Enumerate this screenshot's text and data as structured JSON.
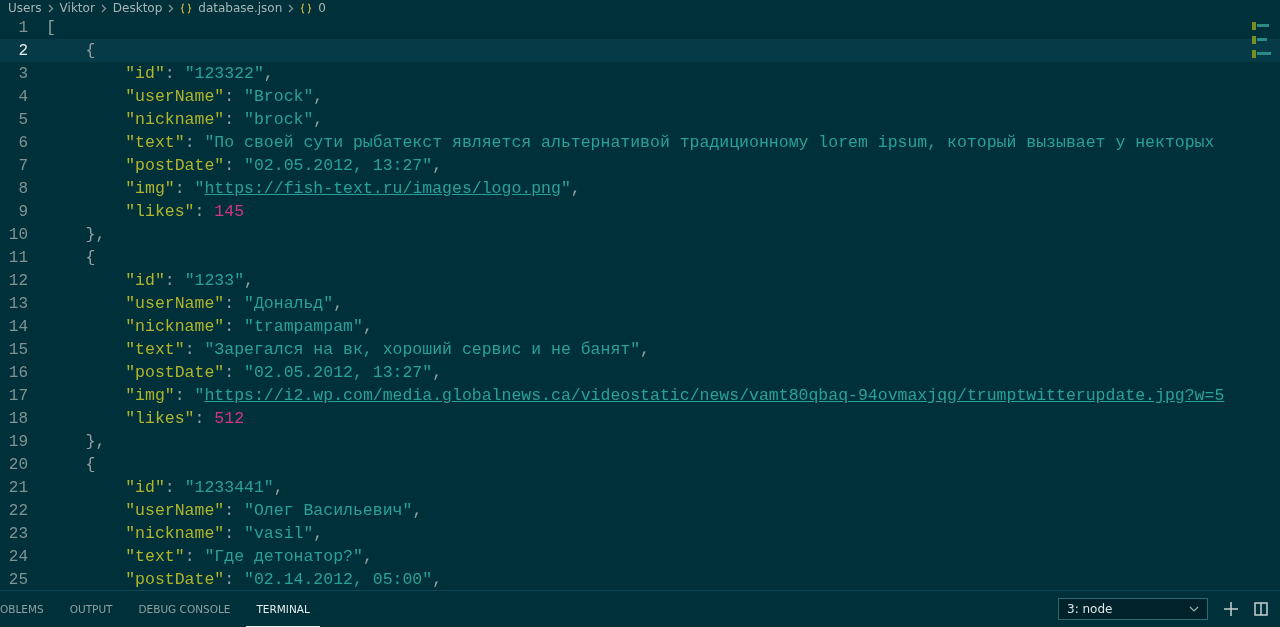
{
  "breadcrumb": [
    {
      "label": "Users",
      "kind": "folder"
    },
    {
      "label": "Viktor",
      "kind": "folder"
    },
    {
      "label": "Desktop",
      "kind": "folder"
    },
    {
      "label": "database.json",
      "kind": "json"
    },
    {
      "label": "0",
      "kind": "json"
    }
  ],
  "editor": {
    "lines": [
      {
        "number": "1",
        "current": false,
        "tokens": [
          {
            "kind": "punct",
            "text": "["
          }
        ]
      },
      {
        "number": "2",
        "current": true,
        "tokens": [
          {
            "kind": "punct",
            "text": "    {"
          }
        ]
      },
      {
        "number": "3",
        "current": false,
        "tokens": [
          {
            "kind": "key",
            "text": "        \"id\""
          },
          {
            "kind": "punct",
            "text": ": "
          },
          {
            "kind": "string",
            "text": "\"123322\""
          },
          {
            "kind": "punct",
            "text": ","
          }
        ]
      },
      {
        "number": "4",
        "current": false,
        "tokens": [
          {
            "kind": "key",
            "text": "        \"userName\""
          },
          {
            "kind": "punct",
            "text": ": "
          },
          {
            "kind": "string",
            "text": "\"Brock\""
          },
          {
            "kind": "punct",
            "text": ","
          }
        ]
      },
      {
        "number": "5",
        "current": false,
        "tokens": [
          {
            "kind": "key",
            "text": "        \"nickname\""
          },
          {
            "kind": "punct",
            "text": ": "
          },
          {
            "kind": "string",
            "text": "\"brock\""
          },
          {
            "kind": "punct",
            "text": ","
          }
        ]
      },
      {
        "number": "6",
        "current": false,
        "tokens": [
          {
            "kind": "key",
            "text": "        \"text\""
          },
          {
            "kind": "punct",
            "text": ": "
          },
          {
            "kind": "string",
            "text": "\"По своей сути рыбатекст является альтернативой традиционному lorem ipsum, который вызывает у некторых"
          }
        ]
      },
      {
        "number": "7",
        "current": false,
        "tokens": [
          {
            "kind": "key",
            "text": "        \"postDate\""
          },
          {
            "kind": "punct",
            "text": ": "
          },
          {
            "kind": "string",
            "text": "\"02.05.2012, 13:27\""
          },
          {
            "kind": "punct",
            "text": ","
          }
        ]
      },
      {
        "number": "8",
        "current": false,
        "tokens": [
          {
            "kind": "key",
            "text": "        \"img\""
          },
          {
            "kind": "punct",
            "text": ": "
          },
          {
            "kind": "string",
            "text": "\""
          },
          {
            "kind": "link",
            "text": "https://fish-text.ru/images/logo.png"
          },
          {
            "kind": "string",
            "text": "\""
          },
          {
            "kind": "punct",
            "text": ","
          }
        ]
      },
      {
        "number": "9",
        "current": false,
        "tokens": [
          {
            "kind": "key",
            "text": "        \"likes\""
          },
          {
            "kind": "punct",
            "text": ": "
          },
          {
            "kind": "number",
            "text": "145"
          }
        ]
      },
      {
        "number": "10",
        "current": false,
        "tokens": [
          {
            "kind": "punct",
            "text": "    },"
          }
        ]
      },
      {
        "number": "11",
        "current": false,
        "tokens": [
          {
            "kind": "punct",
            "text": "    {"
          }
        ]
      },
      {
        "number": "12",
        "current": false,
        "tokens": [
          {
            "kind": "key",
            "text": "        \"id\""
          },
          {
            "kind": "punct",
            "text": ": "
          },
          {
            "kind": "string",
            "text": "\"1233\""
          },
          {
            "kind": "punct",
            "text": ","
          }
        ]
      },
      {
        "number": "13",
        "current": false,
        "tokens": [
          {
            "kind": "key",
            "text": "        \"userName\""
          },
          {
            "kind": "punct",
            "text": ": "
          },
          {
            "kind": "string",
            "text": "\"Дональд\""
          },
          {
            "kind": "punct",
            "text": ","
          }
        ]
      },
      {
        "number": "14",
        "current": false,
        "tokens": [
          {
            "kind": "key",
            "text": "        \"nickname\""
          },
          {
            "kind": "punct",
            "text": ": "
          },
          {
            "kind": "string",
            "text": "\"trampampam\""
          },
          {
            "kind": "punct",
            "text": ","
          }
        ]
      },
      {
        "number": "15",
        "current": false,
        "tokens": [
          {
            "kind": "key",
            "text": "        \"text\""
          },
          {
            "kind": "punct",
            "text": ": "
          },
          {
            "kind": "string",
            "text": "\"Зарегался на вк, хороший сервис и не банят\""
          },
          {
            "kind": "punct",
            "text": ","
          }
        ]
      },
      {
        "number": "16",
        "current": false,
        "tokens": [
          {
            "kind": "key",
            "text": "        \"postDate\""
          },
          {
            "kind": "punct",
            "text": ": "
          },
          {
            "kind": "string",
            "text": "\"02.05.2012, 13:27\""
          },
          {
            "kind": "punct",
            "text": ","
          }
        ]
      },
      {
        "number": "17",
        "current": false,
        "tokens": [
          {
            "kind": "key",
            "text": "        \"img\""
          },
          {
            "kind": "punct",
            "text": ": "
          },
          {
            "kind": "string",
            "text": "\""
          },
          {
            "kind": "link",
            "text": "https://i2.wp.com/media.globalnews.ca/videostatic/news/vamt80qbaq-94ovmaxjqg/trumptwitterupdate.jpg?w=5"
          }
        ]
      },
      {
        "number": "18",
        "current": false,
        "tokens": [
          {
            "kind": "key",
            "text": "        \"likes\""
          },
          {
            "kind": "punct",
            "text": ": "
          },
          {
            "kind": "number",
            "text": "512"
          }
        ]
      },
      {
        "number": "19",
        "current": false,
        "tokens": [
          {
            "kind": "punct",
            "text": "    },"
          }
        ]
      },
      {
        "number": "20",
        "current": false,
        "tokens": [
          {
            "kind": "punct",
            "text": "    {"
          }
        ]
      },
      {
        "number": "21",
        "current": false,
        "tokens": [
          {
            "kind": "key",
            "text": "        \"id\""
          },
          {
            "kind": "punct",
            "text": ": "
          },
          {
            "kind": "string",
            "text": "\"1233441\""
          },
          {
            "kind": "punct",
            "text": ","
          }
        ]
      },
      {
        "number": "22",
        "current": false,
        "tokens": [
          {
            "kind": "key",
            "text": "        \"userName\""
          },
          {
            "kind": "punct",
            "text": ": "
          },
          {
            "kind": "string",
            "text": "\"Олег Васильевич\""
          },
          {
            "kind": "punct",
            "text": ","
          }
        ]
      },
      {
        "number": "23",
        "current": false,
        "tokens": [
          {
            "kind": "key",
            "text": "        \"nickname\""
          },
          {
            "kind": "punct",
            "text": ": "
          },
          {
            "kind": "string",
            "text": "\"vasil\""
          },
          {
            "kind": "punct",
            "text": ","
          }
        ]
      },
      {
        "number": "24",
        "current": false,
        "tokens": [
          {
            "kind": "key",
            "text": "        \"text\""
          },
          {
            "kind": "punct",
            "text": ": "
          },
          {
            "kind": "string",
            "text": "\"Где детонатор?\""
          },
          {
            "kind": "punct",
            "text": ","
          }
        ]
      },
      {
        "number": "25",
        "current": false,
        "tokens": [
          {
            "kind": "key",
            "text": "        \"postDate\""
          },
          {
            "kind": "punct",
            "text": ": "
          },
          {
            "kind": "string",
            "text": "\"02.14.2012, 05:00\""
          },
          {
            "kind": "punct",
            "text": ","
          }
        ]
      }
    ]
  },
  "panel": {
    "tabs": [
      {
        "label": "OBLEMS",
        "selected": false
      },
      {
        "label": "OUTPUT",
        "selected": false
      },
      {
        "label": "DEBUG CONSOLE",
        "selected": false
      },
      {
        "label": "TERMINAL",
        "selected": true
      }
    ],
    "terminal_select": {
      "value": "3: node"
    }
  }
}
